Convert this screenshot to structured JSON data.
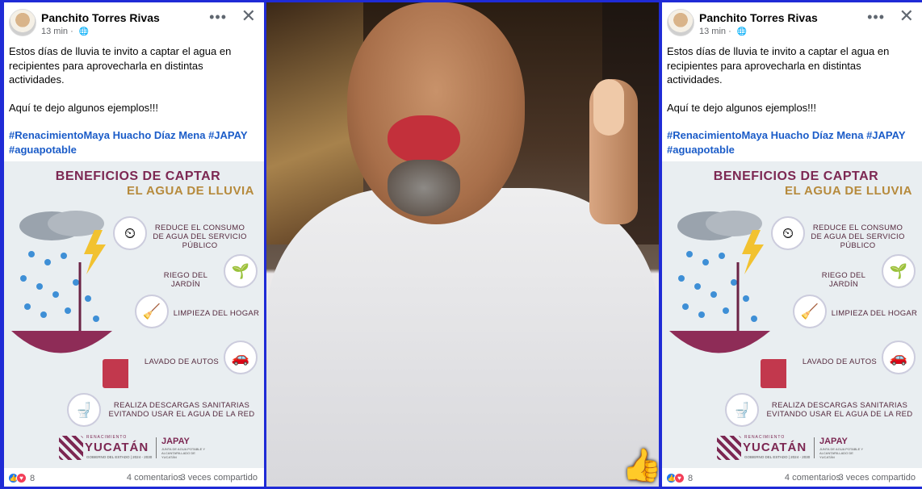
{
  "posts": {
    "author": "Panchito Torres Rivas",
    "time": "13 min",
    "privacy_icon": "globe-icon",
    "more_icon": "more-options-icon",
    "close_icon": "close-icon",
    "text_line1": "Estos días de lluvia te invito a captar el agua en recipientes para aprovecharla en distintas actividades.",
    "text_line2": "Aquí te dejo algunos ejemplos!!!",
    "hashtags": "#RenacimientoMaya Huacho Díaz Mena #JAPAY #aguapotable",
    "infographic": {
      "title1": "BENEFICIOS DE CAPTAR",
      "title2": "EL AGUA DE LLUVIA",
      "benefits": [
        "REDUCE EL CONSUMO DE AGUA DEL SERVICIO PÚBLICO",
        "RIEGO DEL JARDÍN",
        "LIMPIEZA DEL HOGAR",
        "LAVADO DE AUTOS",
        "REALIZA DESCARGAS SANITARIAS EVITANDO USAR EL AGUA DE LA RED"
      ],
      "logo_ren": "RENACIMIENTO",
      "logo_yuc": "YUCATÁN",
      "logo_gob": "GOBIERNO DEL ESTADO | 2024 - 2030",
      "logo_japay": "JAPAY",
      "logo_japay_sub": "JUNTA DE AGUA POTABLE Y ALCANTARILLADO DE YUCATÁN"
    },
    "reactions_count": "8",
    "comments": "4 comentarios",
    "shares": "3 veces compartido"
  },
  "colors": {
    "background": "#1f2bd6",
    "hashtag": "#1b5cc8",
    "infographic_primary": "#7c2752",
    "infographic_accent": "#b68a3c"
  }
}
